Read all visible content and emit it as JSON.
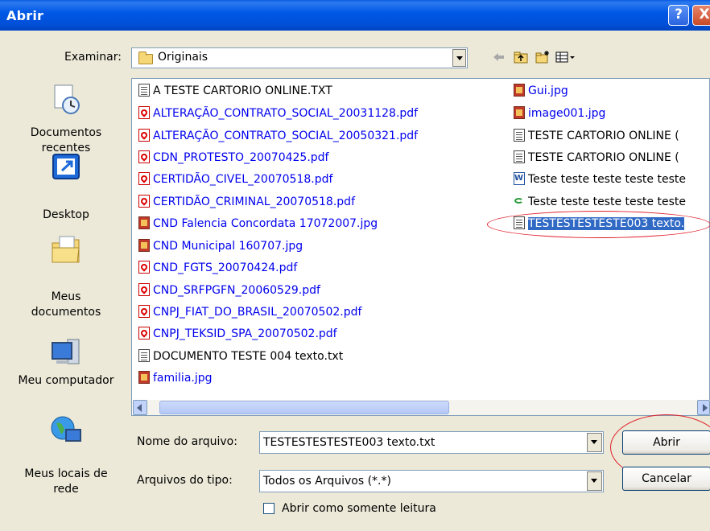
{
  "window": {
    "title": "Abrir",
    "help_glyph": "?",
    "close_glyph": "X"
  },
  "lookin": {
    "label": "Examinar:",
    "value": "Originais"
  },
  "toolbar": {
    "icons": [
      "back-icon",
      "up-folder-icon",
      "new-folder-icon",
      "view-menu-icon"
    ]
  },
  "places": [
    {
      "label": "Documentos recentes",
      "icon": "recent-documents-icon"
    },
    {
      "label": "Desktop",
      "icon": "desktop-icon"
    },
    {
      "label": "Meus documentos",
      "icon": "my-documents-icon"
    },
    {
      "label": "Meu computador",
      "icon": "my-computer-icon"
    },
    {
      "label": "Meus locais de rede",
      "icon": "network-places-icon"
    }
  ],
  "files": [
    {
      "name": "A TESTE CARTORIO ONLINE.TXT",
      "type": "txt"
    },
    {
      "name": "ALTERAÇÃO_CONTRATO_SOCIAL_20031128.pdf",
      "type": "pdf"
    },
    {
      "name": "ALTERAÇÃO_CONTRATO_SOCIAL_20050321.pdf",
      "type": "pdf"
    },
    {
      "name": "CDN_PROTESTO_20070425.pdf",
      "type": "pdf"
    },
    {
      "name": "CERTIDÃO_CIVEL_20070518.pdf",
      "type": "pdf"
    },
    {
      "name": "CERTIDÃO_CRIMINAL_20070518.pdf",
      "type": "pdf"
    },
    {
      "name": "CND Falencia Concordata 17072007.jpg",
      "type": "jpg"
    },
    {
      "name": "CND Municipal 160707.jpg",
      "type": "jpg"
    },
    {
      "name": "CND_FGTS_20070424.pdf",
      "type": "pdf"
    },
    {
      "name": "CND_SRFPGFN_20060529.pdf",
      "type": "pdf"
    },
    {
      "name": "CNPJ_FIAT_DO_BRASIL_20070502.pdf",
      "type": "pdf"
    },
    {
      "name": "CNPJ_TEKSID_SPA_20070502.pdf",
      "type": "pdf"
    },
    {
      "name": "DOCUMENTO TESTE 004 texto.txt",
      "type": "txt"
    },
    {
      "name": "familia.jpg",
      "type": "jpg"
    },
    {
      "name": "Gui.jpg",
      "type": "jpg"
    },
    {
      "name": "image001.jpg",
      "type": "jpg"
    },
    {
      "name": "TESTE CARTORIO ONLINE (",
      "type": "txt"
    },
    {
      "name": "TESTE CARTORIO ONLINE (",
      "type": "txt"
    },
    {
      "name": "Teste teste teste teste teste",
      "type": "doc"
    },
    {
      "name": "Teste teste teste teste teste",
      "type": "lnk"
    },
    {
      "name": "TESTESTESTESTE003 texto.",
      "type": "txt",
      "selected": true
    }
  ],
  "filename": {
    "label": "Nome do arquivo:",
    "value": "TESTESTESTESTE003 texto.txt"
  },
  "filetype": {
    "label": "Arquivos do tipo:",
    "value": "Todos os Arquivos (*.*)"
  },
  "buttons": {
    "open": "Abrir",
    "cancel": "Cancelar"
  },
  "readonly": {
    "label": "Abrir como somente leitura",
    "checked": false
  },
  "colors": {
    "titlebar": "#0058E6",
    "selection": "#316AC5",
    "annotation": "#E0202A",
    "link_text": "#0000EE"
  }
}
